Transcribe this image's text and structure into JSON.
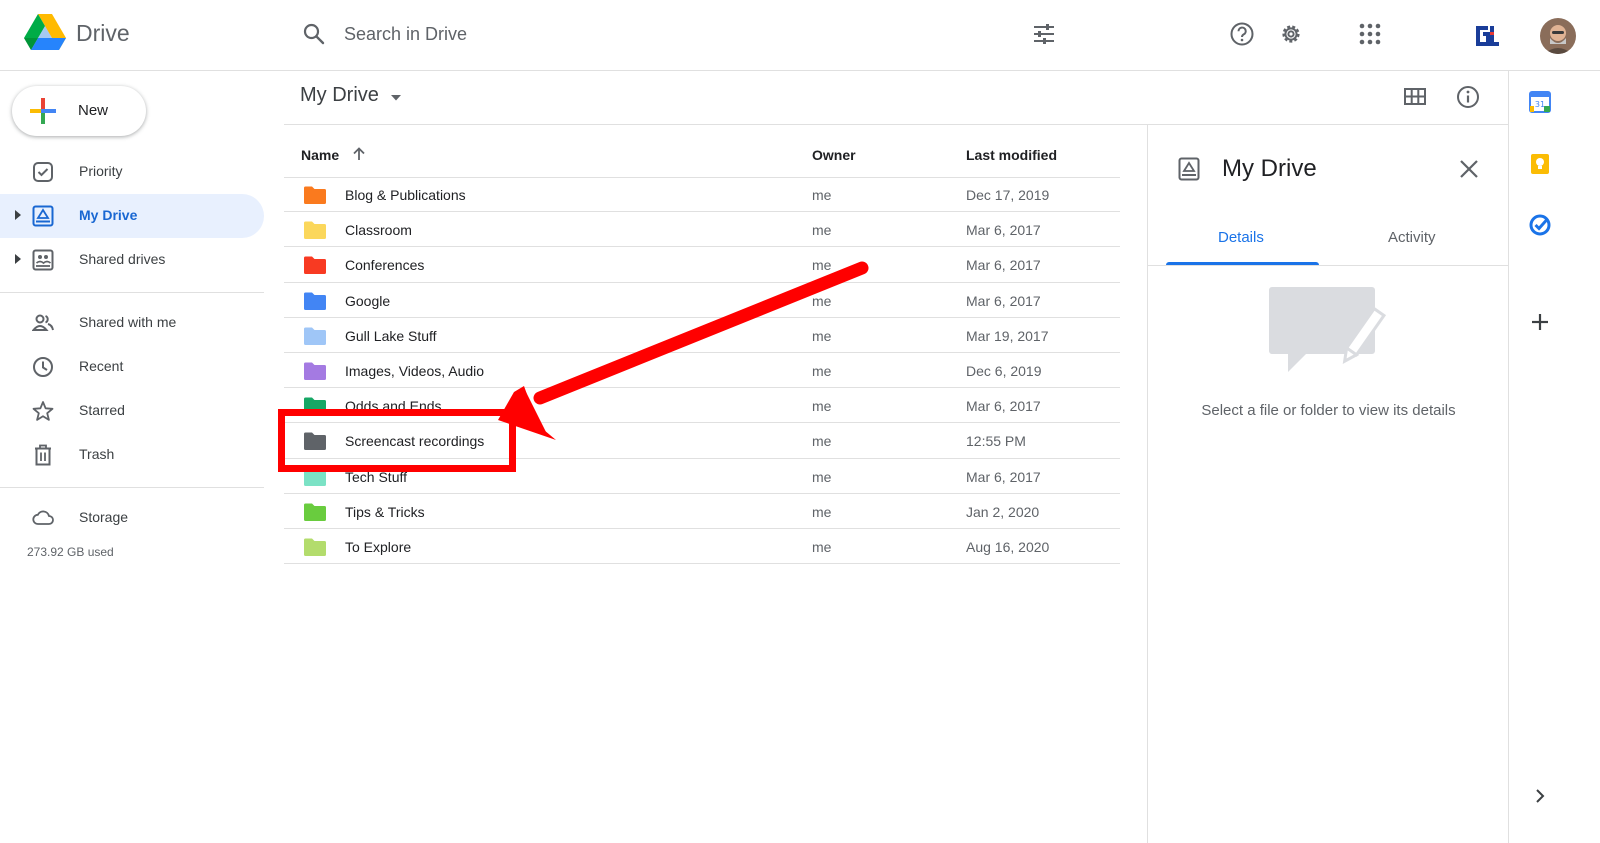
{
  "header": {
    "app_name": "Drive",
    "search_placeholder": "Search in Drive",
    "icons": [
      "search-icon",
      "search-options-icon",
      "help-icon",
      "settings-icon",
      "apps-icon",
      "org-logo",
      "avatar"
    ]
  },
  "sidebar": {
    "new_label": "New",
    "items": [
      {
        "label": "Priority",
        "icon": "priority-icon"
      },
      {
        "label": "My Drive",
        "icon": "my-drive-icon",
        "active": true
      },
      {
        "label": "Shared drives",
        "icon": "shared-drives-icon"
      },
      {
        "label": "Shared with me",
        "icon": "shared-with-me-icon"
      },
      {
        "label": "Recent",
        "icon": "clock-icon"
      },
      {
        "label": "Starred",
        "icon": "star-icon"
      },
      {
        "label": "Trash",
        "icon": "trash-icon"
      },
      {
        "label": "Storage",
        "icon": "cloud-icon"
      }
    ],
    "storage_used": "273.92 GB used"
  },
  "main": {
    "title": "My Drive",
    "columns": {
      "name": "Name",
      "owner": "Owner",
      "modified": "Last modified"
    },
    "files": [
      {
        "name": "Blog & Publications",
        "owner": "me",
        "modified": "Dec 17, 2019",
        "color": "#fa7a1e"
      },
      {
        "name": "Classroom",
        "owner": "me",
        "modified": "Mar 6, 2017",
        "color": "#fbd75b"
      },
      {
        "name": "Conferences",
        "owner": "me",
        "modified": "Mar 6, 2017",
        "color": "#f83a22"
      },
      {
        "name": "Google",
        "owner": "me",
        "modified": "Mar 6, 2017",
        "color": "#4285f4"
      },
      {
        "name": "Gull Lake Stuff",
        "owner": "me",
        "modified": "Mar 19, 2017",
        "color": "#9fc6f7"
      },
      {
        "name": "Images, Videos, Audio",
        "owner": "me",
        "modified": "Dec 6, 2019",
        "color": "#a47ae2"
      },
      {
        "name": "Odds and Ends",
        "owner": "me",
        "modified": "Mar 6, 2017",
        "color": "#16a765"
      },
      {
        "name": "Screencast recordings",
        "owner": "me",
        "modified": "12:55 PM",
        "color": "#5f6368"
      },
      {
        "name": "Tech Stuff",
        "owner": "me",
        "modified": "Mar 6, 2017",
        "color": "#7be2c5"
      },
      {
        "name": "Tips & Tricks",
        "owner": "me",
        "modified": "Jan 2, 2020",
        "color": "#69cc3e"
      },
      {
        "name": "To Explore",
        "owner": "me",
        "modified": "Aug 16, 2020",
        "color": "#b3dc6c"
      }
    ]
  },
  "details_panel": {
    "title": "My Drive",
    "tabs": [
      "Details",
      "Activity"
    ],
    "active_tab": "Details",
    "empty_message": "Select a file or folder to view its details"
  },
  "side_apps": [
    "calendar-icon",
    "keep-icon",
    "tasks-icon",
    "add-icon",
    "chevron-right-icon"
  ],
  "annotation": {
    "color": "#ff0000",
    "target": "Screencast recordings"
  }
}
